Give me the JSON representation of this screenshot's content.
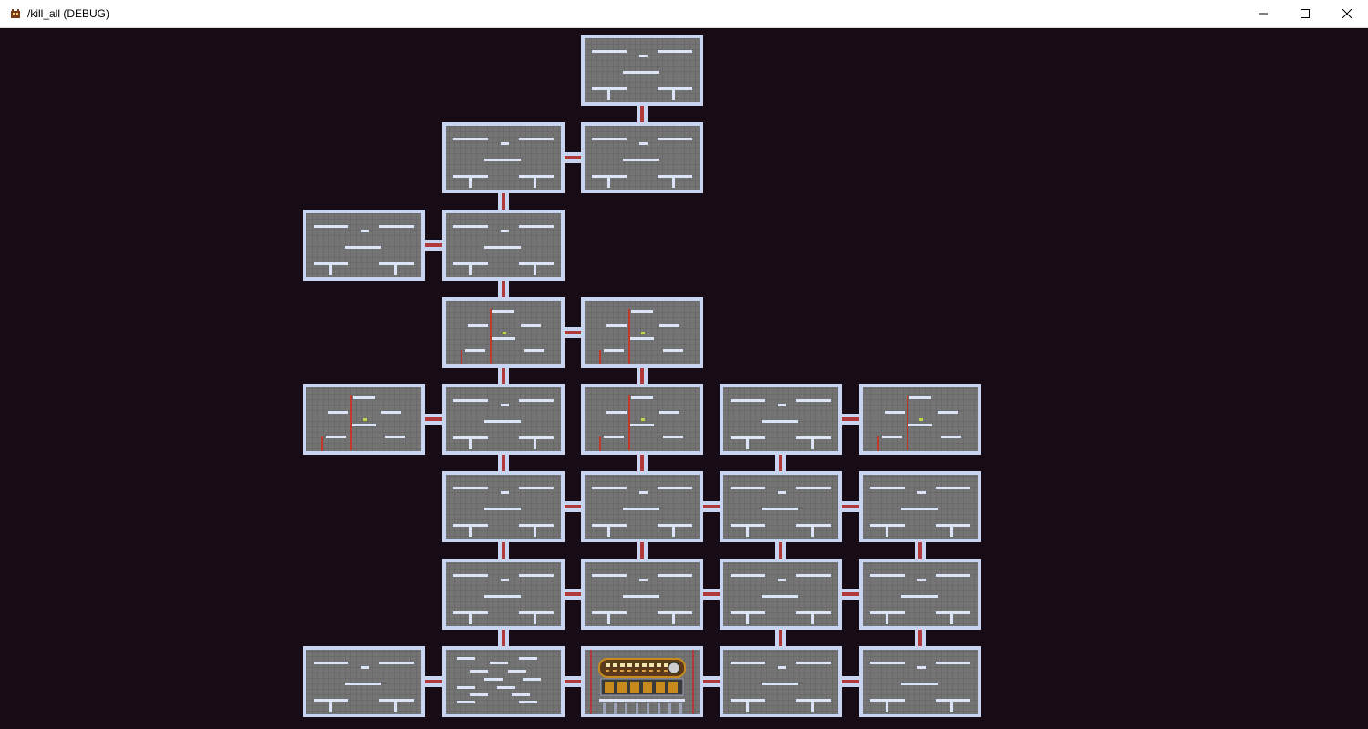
{
  "window": {
    "title": "/kill_all (DEBUG)",
    "icon": "game-app-icon",
    "controls": [
      "minimize-icon",
      "maximize-icon",
      "close-icon"
    ]
  },
  "colors": {
    "background": "#170b16",
    "room_floor": "#777777",
    "room_wall": "#c8d4f0",
    "platform": "#dce4f8",
    "door": "#b03a3a",
    "laser": "#c0392b",
    "shop_banner": "#c98a1d"
  },
  "map": {
    "grid_columns": 5,
    "grid_rows": 8,
    "rooms": [
      {
        "col": 2,
        "row": 0,
        "type": "standard"
      },
      {
        "col": 1,
        "row": 1,
        "type": "standard"
      },
      {
        "col": 2,
        "row": 1,
        "type": "standard"
      },
      {
        "col": 0,
        "row": 2,
        "type": "standard"
      },
      {
        "col": 1,
        "row": 2,
        "type": "standard"
      },
      {
        "col": 1,
        "row": 3,
        "type": "laser"
      },
      {
        "col": 2,
        "row": 3,
        "type": "laser"
      },
      {
        "col": 0,
        "row": 4,
        "type": "laser"
      },
      {
        "col": 1,
        "row": 4,
        "type": "standard"
      },
      {
        "col": 2,
        "row": 4,
        "type": "laser"
      },
      {
        "col": 3,
        "row": 4,
        "type": "standard"
      },
      {
        "col": 4,
        "row": 4,
        "type": "laser"
      },
      {
        "col": 1,
        "row": 5,
        "type": "standard"
      },
      {
        "col": 2,
        "row": 5,
        "type": "standard"
      },
      {
        "col": 3,
        "row": 5,
        "type": "standard"
      },
      {
        "col": 4,
        "row": 5,
        "type": "standard"
      },
      {
        "col": 1,
        "row": 6,
        "type": "standard"
      },
      {
        "col": 2,
        "row": 6,
        "type": "standard"
      },
      {
        "col": 3,
        "row": 6,
        "type": "standard"
      },
      {
        "col": 4,
        "row": 6,
        "type": "standard"
      },
      {
        "col": 0,
        "row": 7,
        "type": "standard"
      },
      {
        "col": 1,
        "row": 7,
        "type": "scattered"
      },
      {
        "col": 2,
        "row": 7,
        "type": "shop"
      },
      {
        "col": 3,
        "row": 7,
        "type": "standard"
      },
      {
        "col": 4,
        "row": 7,
        "type": "standard"
      }
    ],
    "horizontal_doors": [
      [
        1,
        1,
        2,
        1
      ],
      [
        0,
        2,
        1,
        2
      ],
      [
        1,
        3,
        2,
        3
      ],
      [
        0,
        4,
        1,
        4
      ],
      [
        3,
        4,
        4,
        4
      ],
      [
        1,
        5,
        2,
        5
      ],
      [
        2,
        5,
        3,
        5
      ],
      [
        3,
        5,
        4,
        5
      ],
      [
        1,
        6,
        2,
        6
      ],
      [
        2,
        6,
        3,
        6
      ],
      [
        3,
        6,
        4,
        6
      ],
      [
        0,
        7,
        1,
        7
      ],
      [
        1,
        7,
        2,
        7
      ],
      [
        2,
        7,
        3,
        7
      ],
      [
        3,
        7,
        4,
        7
      ]
    ],
    "vertical_doors": [
      [
        2,
        0,
        2,
        1
      ],
      [
        1,
        1,
        1,
        2
      ],
      [
        1,
        2,
        1,
        3
      ],
      [
        1,
        3,
        1,
        4
      ],
      [
        2,
        3,
        2,
        4
      ],
      [
        1,
        4,
        1,
        5
      ],
      [
        2,
        4,
        2,
        5
      ],
      [
        3,
        4,
        3,
        5
      ],
      [
        1,
        5,
        1,
        6
      ],
      [
        2,
        5,
        2,
        6
      ],
      [
        3,
        5,
        3,
        6
      ],
      [
        4,
        5,
        4,
        6
      ],
      [
        1,
        6,
        1,
        7
      ],
      [
        3,
        6,
        3,
        7
      ],
      [
        4,
        6,
        4,
        7
      ]
    ]
  }
}
